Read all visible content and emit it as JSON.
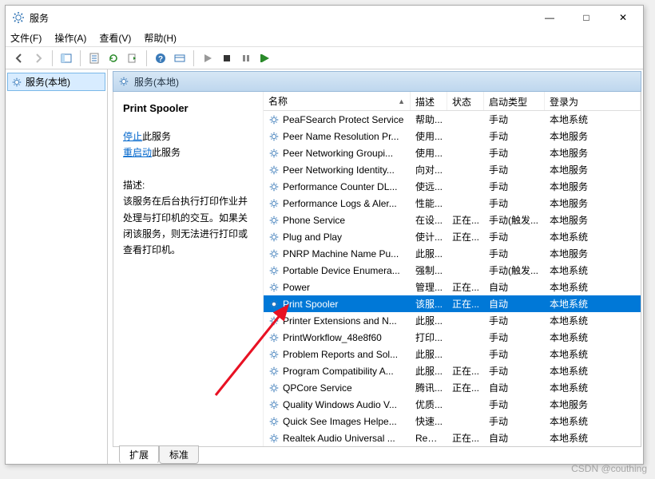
{
  "window": {
    "title": "服务"
  },
  "menu": {
    "file": "文件(F)",
    "action": "操作(A)",
    "view": "查看(V)",
    "help": "帮助(H)"
  },
  "nav": {
    "root": "服务(本地)"
  },
  "header": "服务(本地)",
  "detail": {
    "name": "Print Spooler",
    "stop_label": "停止",
    "stop_suffix": "此服务",
    "restart_label": "重启动",
    "restart_suffix": "此服务",
    "desc_label": "描述:",
    "desc": "该服务在后台执行打印作业并处理与打印机的交互。如果关闭该服务，则无法进行打印或查看打印机。"
  },
  "cols": {
    "name": "名称",
    "desc": "描述",
    "status": "状态",
    "startup": "启动类型",
    "logon": "登录为"
  },
  "rows": [
    {
      "name": "PeaFSearch Protect Service",
      "desc": "帮助...",
      "status": "",
      "startup": "手动",
      "logon": "本地系统"
    },
    {
      "name": "Peer Name Resolution Pr...",
      "desc": "使用...",
      "status": "",
      "startup": "手动",
      "logon": "本地服务"
    },
    {
      "name": "Peer Networking Groupi...",
      "desc": "使用...",
      "status": "",
      "startup": "手动",
      "logon": "本地服务"
    },
    {
      "name": "Peer Networking Identity...",
      "desc": "向对...",
      "status": "",
      "startup": "手动",
      "logon": "本地服务"
    },
    {
      "name": "Performance Counter DL...",
      "desc": "使远...",
      "status": "",
      "startup": "手动",
      "logon": "本地服务"
    },
    {
      "name": "Performance Logs & Aler...",
      "desc": "性能...",
      "status": "",
      "startup": "手动",
      "logon": "本地服务"
    },
    {
      "name": "Phone Service",
      "desc": "在设...",
      "status": "正在...",
      "startup": "手动(触发...",
      "logon": "本地服务"
    },
    {
      "name": "Plug and Play",
      "desc": "使计...",
      "status": "正在...",
      "startup": "手动",
      "logon": "本地系统"
    },
    {
      "name": "PNRP Machine Name Pu...",
      "desc": "此服...",
      "status": "",
      "startup": "手动",
      "logon": "本地服务"
    },
    {
      "name": "Portable Device Enumera...",
      "desc": "强制...",
      "status": "",
      "startup": "手动(触发...",
      "logon": "本地系统"
    },
    {
      "name": "Power",
      "desc": "管理...",
      "status": "正在...",
      "startup": "自动",
      "logon": "本地系统"
    },
    {
      "name": "Print Spooler",
      "desc": "该服...",
      "status": "正在...",
      "startup": "自动",
      "logon": "本地系统",
      "sel": true
    },
    {
      "name": "Printer Extensions and N...",
      "desc": "此服...",
      "status": "",
      "startup": "手动",
      "logon": "本地系统"
    },
    {
      "name": "PrintWorkflow_48e8f60",
      "desc": "打印...",
      "status": "",
      "startup": "手动",
      "logon": "本地系统"
    },
    {
      "name": "Problem Reports and Sol...",
      "desc": "此服...",
      "status": "",
      "startup": "手动",
      "logon": "本地系统"
    },
    {
      "name": "Program Compatibility A...",
      "desc": "此服...",
      "status": "正在...",
      "startup": "手动",
      "logon": "本地系统"
    },
    {
      "name": "QPCore Service",
      "desc": "腾讯...",
      "status": "正在...",
      "startup": "自动",
      "logon": "本地系统"
    },
    {
      "name": "Quality Windows Audio V...",
      "desc": "优质...",
      "status": "",
      "startup": "手动",
      "logon": "本地服务"
    },
    {
      "name": "Quick See Images Helpe...",
      "desc": "快速...",
      "status": "",
      "startup": "手动",
      "logon": "本地系统"
    },
    {
      "name": "Realtek Audio Universal ...",
      "desc": "Real...",
      "status": "正在...",
      "startup": "自动",
      "logon": "本地系统"
    }
  ],
  "tabs": {
    "ext": "扩展",
    "std": "标准"
  },
  "watermark": "CSDN @couthing"
}
